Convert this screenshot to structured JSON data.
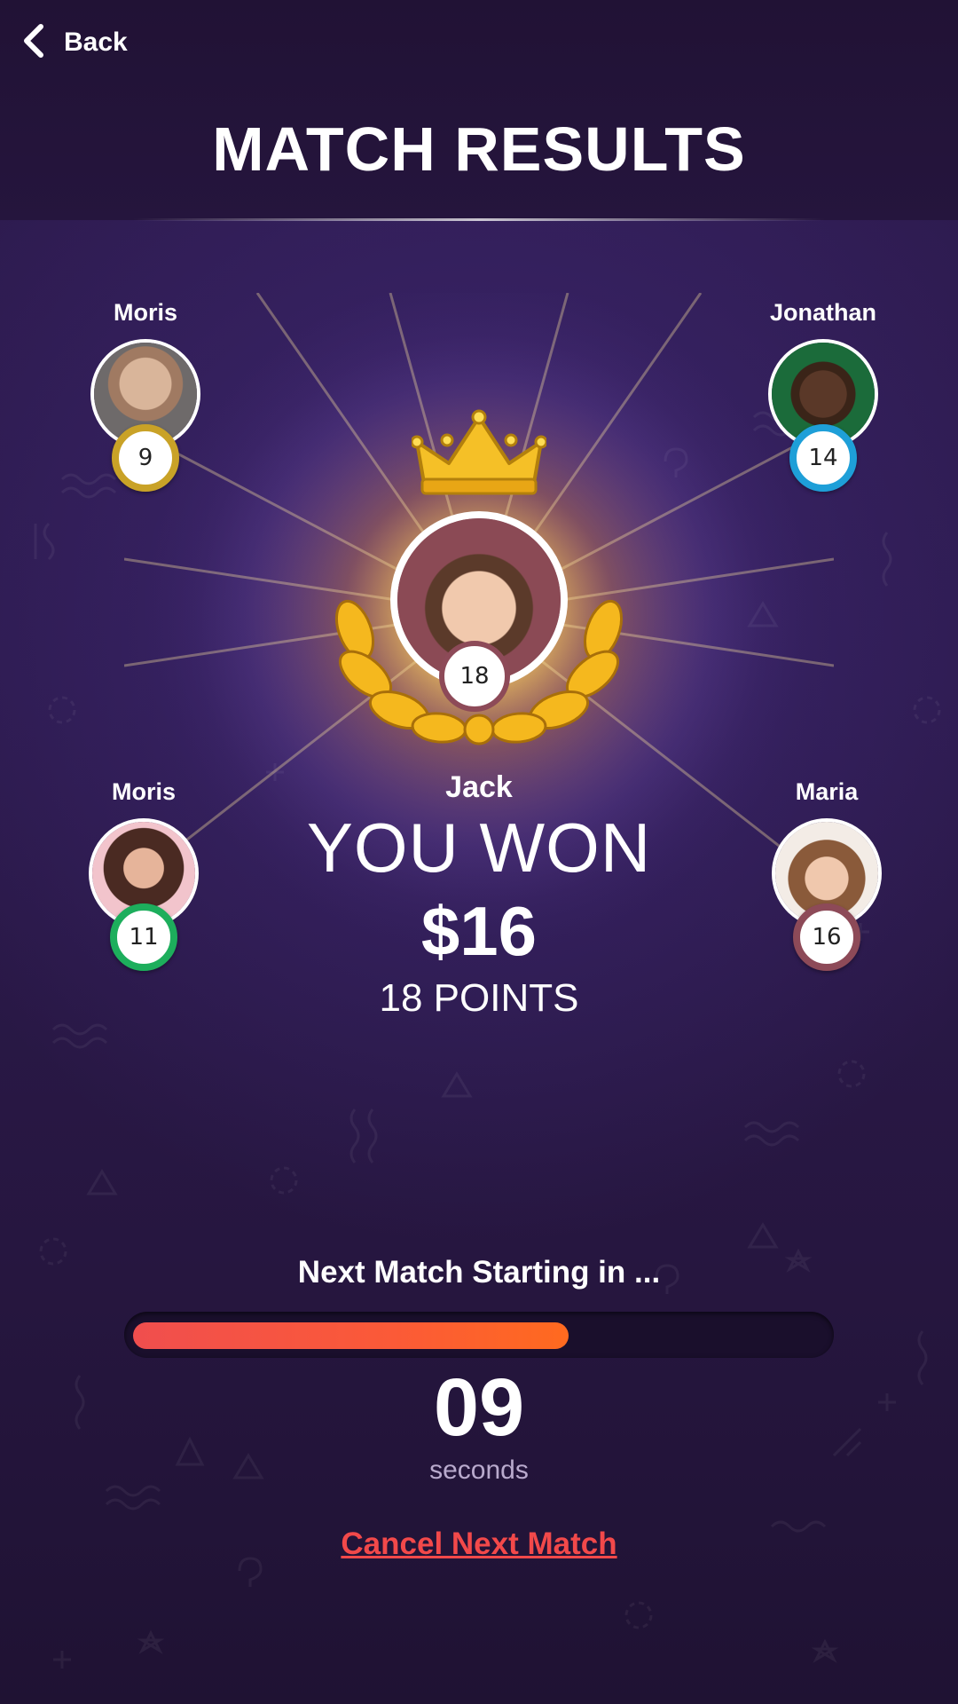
{
  "header": {
    "back_label": "Back",
    "title": "MATCH RESULTS"
  },
  "players": [
    {
      "name": "Moris",
      "score": "9",
      "ring_color": "#c9a227"
    },
    {
      "name": "Jonathan",
      "score": "14",
      "ring_color": "#1e9fd8"
    },
    {
      "name": "Moris",
      "score": "11",
      "ring_color": "#1dae5c"
    },
    {
      "name": "Maria",
      "score": "16",
      "ring_color": "#8d4a58"
    }
  ],
  "winner": {
    "name": "Jack",
    "score": "18",
    "headline": "YOU WON",
    "prize": "$16",
    "points": "18 POINTS"
  },
  "next_match": {
    "label": "Next Match Starting in ...",
    "countdown": "09",
    "unit": "seconds",
    "progress": 0.63,
    "cancel_label": "Cancel Next Match"
  },
  "colors": {
    "progress_start": "#f04e4e",
    "progress_end": "#ff6a1f",
    "cancel": "#f2494a",
    "gold": "#f5b81e"
  },
  "icons": [
    "chevron-left-icon",
    "crown-icon",
    "laurel-wreath-icon"
  ]
}
